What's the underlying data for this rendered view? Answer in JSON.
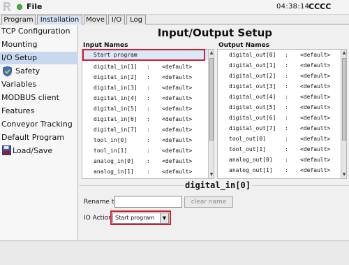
{
  "app": {
    "file_menu": "File",
    "time": "04:38:14",
    "robot_name": "CCCC",
    "accent": "#d0202e",
    "status_color": "#3cb13c"
  },
  "tabs": [
    {
      "label": "Program"
    },
    {
      "label": "Installation"
    },
    {
      "label": "Move"
    },
    {
      "label": "I/O"
    },
    {
      "label": "Log"
    }
  ],
  "sidebar": {
    "items": [
      {
        "label": "TCP Configuration"
      },
      {
        "label": "Mounting"
      },
      {
        "label": "I/O Setup"
      },
      {
        "label": "Safety"
      },
      {
        "label": "Variables"
      },
      {
        "label": "MODBUS client"
      },
      {
        "label": "Features"
      },
      {
        "label": "Conveyor Tracking"
      },
      {
        "label": "Default Program"
      },
      {
        "label": "Load/Save"
      }
    ]
  },
  "main": {
    "title": "Input/Output Setup",
    "input_names_label": "Input Names",
    "output_names_label": "Output Names",
    "separator": ":",
    "inputs": [
      {
        "name": "Start program",
        "value": ""
      },
      {
        "name": "digital_in[1]",
        "value": "<default>"
      },
      {
        "name": "digital_in[2]",
        "value": "<default>"
      },
      {
        "name": "digital_in[3]",
        "value": "<default>"
      },
      {
        "name": "digital_in[4]",
        "value": "<default>"
      },
      {
        "name": "digital_in[5]",
        "value": "<default>"
      },
      {
        "name": "digital_in[6]",
        "value": "<default>"
      },
      {
        "name": "digital_in[7]",
        "value": "<default>"
      },
      {
        "name": "tool_in[0]",
        "value": "<default>"
      },
      {
        "name": "tool_in[1]",
        "value": "<default>"
      },
      {
        "name": "analog_in[0]",
        "value": "<default>"
      },
      {
        "name": "analog_in[1]",
        "value": "<default>"
      }
    ],
    "outputs": [
      {
        "name": "digital_out[0]",
        "value": "<default>"
      },
      {
        "name": "digital_out[1]",
        "value": "<default>"
      },
      {
        "name": "digital_out[2]",
        "value": "<default>"
      },
      {
        "name": "digital_out[3]",
        "value": "<default>"
      },
      {
        "name": "digital_out[4]",
        "value": "<default>"
      },
      {
        "name": "digital_out[5]",
        "value": "<default>"
      },
      {
        "name": "digital_out[6]",
        "value": "<default>"
      },
      {
        "name": "digital_out[7]",
        "value": "<default>"
      },
      {
        "name": "tool_out[0]",
        "value": "<default>"
      },
      {
        "name": "tool_out[1]",
        "value": "<default>"
      },
      {
        "name": "analog_out[0]",
        "value": "<default>"
      },
      {
        "name": "analog_out[1]",
        "value": "<default>"
      }
    ],
    "detail": {
      "title": "digital_in[0]",
      "rename_label": "Rename to",
      "rename_value": "",
      "clear_label": "clear name",
      "io_action_label": "IO Action:",
      "io_action_value": "Start program"
    }
  }
}
